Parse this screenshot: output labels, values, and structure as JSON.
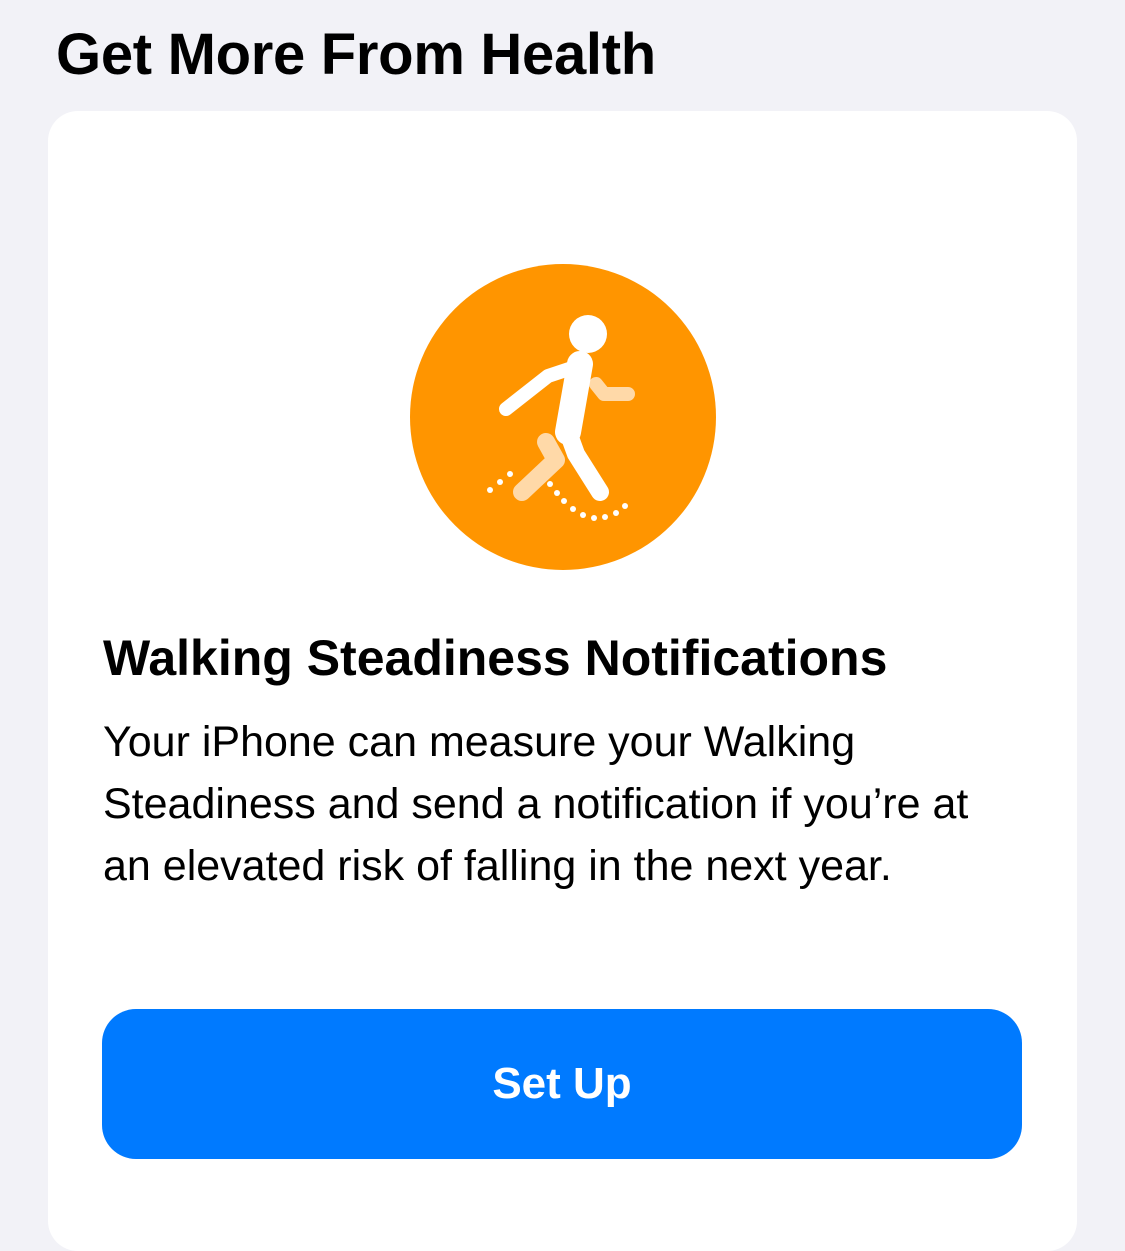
{
  "section": {
    "title": "Get More From Health"
  },
  "card": {
    "icon": "walking-steadiness-icon",
    "title": "Walking Steadiness Notifications",
    "body": "Your iPhone can measure your Walking Steadiness and send a notification if you’re at an elevated risk of falling in the next year.",
    "button_label": "Set Up"
  },
  "colors": {
    "background": "#f2f2f7",
    "card": "#ffffff",
    "icon_orange": "#ff9500",
    "accent_blue": "#007aff"
  }
}
